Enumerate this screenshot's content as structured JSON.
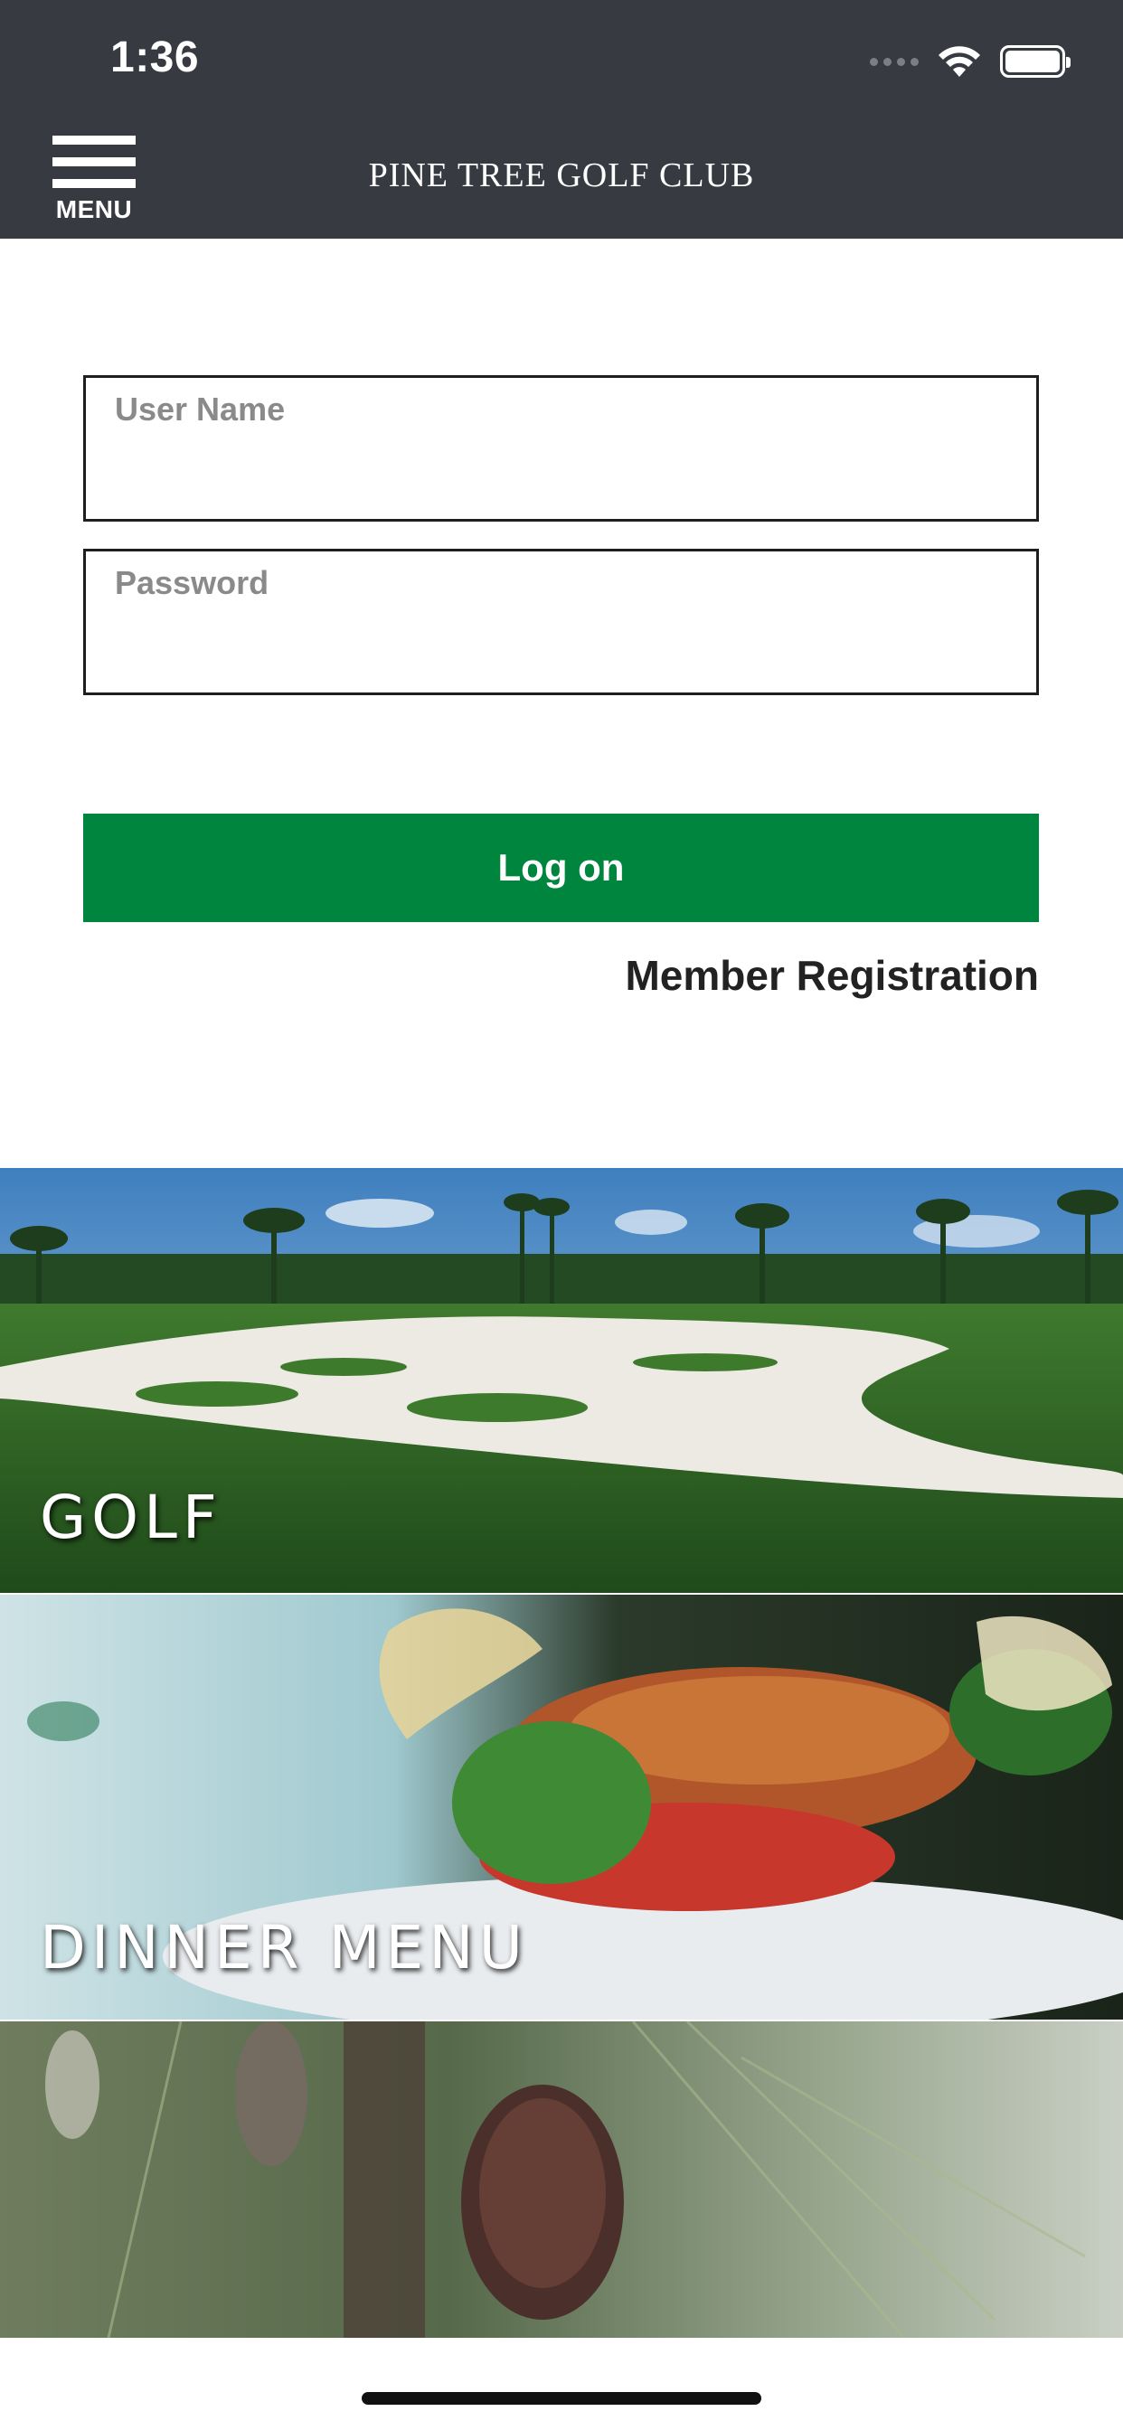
{
  "status_bar": {
    "time": "1:36",
    "icons": [
      "signal-dots-icon",
      "wifi-icon",
      "battery-icon"
    ]
  },
  "header": {
    "menu_label": "MENU",
    "title": "PINE TREE GOLF CLUB",
    "background": "#373b41"
  },
  "login": {
    "username_placeholder": "User Name",
    "username_value": "",
    "password_placeholder": "Password",
    "password_value": "",
    "logon_label": "Log on",
    "logon_color": "#00853e",
    "register_label": "Member Registration"
  },
  "tiles": [
    {
      "label": "GOLF",
      "image": "golf-course-photo"
    },
    {
      "label": "DINNER MENU",
      "image": "plated-dinner-photo"
    },
    {
      "label": "",
      "image": "pine-cone-photo"
    }
  ]
}
